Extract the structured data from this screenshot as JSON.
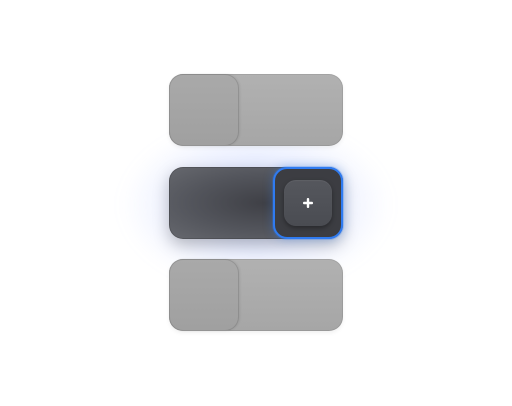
{
  "toggles": [
    {
      "state": "off"
    },
    {
      "state": "on",
      "focused": true,
      "knob_icon": "plus-icon"
    },
    {
      "state": "off"
    }
  ],
  "colors": {
    "focus_ring": "#2f7bf1",
    "track_off": "#aaaaaa",
    "track_on": "#4a4b50",
    "glow": "#8ca5ff"
  }
}
